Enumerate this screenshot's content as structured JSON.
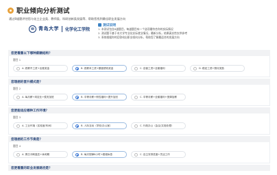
{
  "header": {
    "title": "职业倾向分析测试",
    "subtitle": "通过8道题评估您与化工企业类、教师类、科研创新类发展等、帮助您找到最佳职业发展方向"
  },
  "logo": {
    "university": "青岛大学",
    "college": "化学化工学院"
  },
  "instructions": {
    "title": "测试说明",
    "items": [
      "1. 本测试包含8道题目，每道题目有一个选项最符合你的实际情况",
      "2. 测试题干基于本大学专业化实际就业情况，最新分析，结果真实性仅供参考",
      "3. 系统根据你的回答给出职业倾向分析，帮助您了解最适合的发展方向"
    ]
  },
  "questions": [
    {
      "title": "您更看重以下哪种薪酬结构？",
      "label": "题目 1",
      "options": [
        "A. 底薪不工资+出差奖金",
        "B. 底薪本工资+额度绩效奖金",
        "C. 自营工资+全套福利",
        "D. 稳定工资+照月奖励"
      ],
      "selected": 1
    },
    {
      "title": "您理想的晋升模式是？",
      "label": "题目 2",
      "options": [
        "A. 每月薪+岗定业+侯安加班",
        "B. 中等月薪+侧性福利+提升加班",
        "C. 中等月薪+全套福利+宽弹加薪"
      ],
      "selected": 1
    },
    {
      "title": "您更能适应哪种工作环境？",
      "label": "题目 3",
      "options": [
        "A. 工业环境（实验室/车间）",
        "B. 人际互动（学校/办公室）",
        "C. 行政办公（会议/文档处理）"
      ],
      "selected": 1
    },
    {
      "title": "您理想的工作节奏是？",
      "label": "题目 4",
      "options": [
        "A. 周日冲刺高压+休闲期",
        "B. 每天规律8小时+稳增休息",
        "C. 自主安排进度+灵活工作"
      ],
      "selected": 1
    },
    {
      "title": "您更看重的职业发展路径是？",
      "label": "",
      "options": [],
      "selected": -1
    }
  ]
}
